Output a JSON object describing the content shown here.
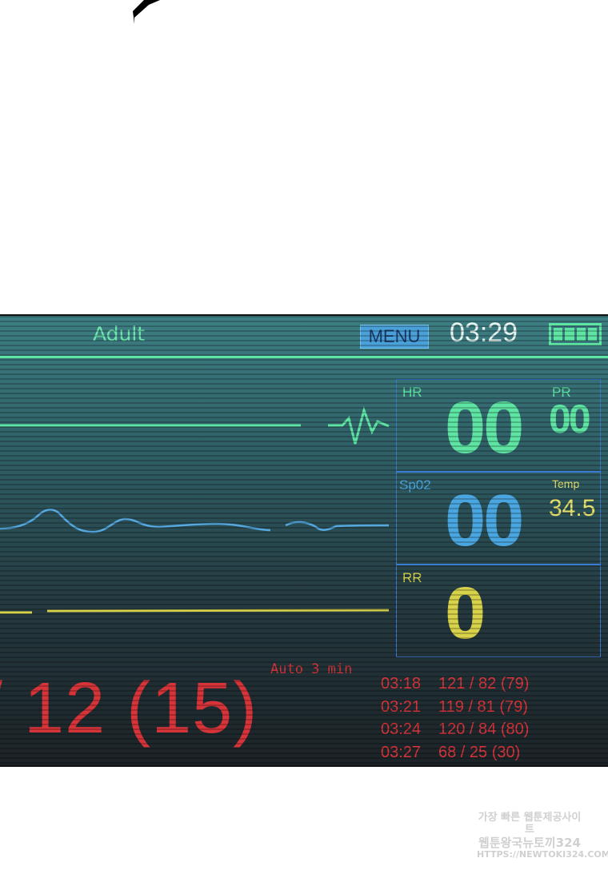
{
  "header": {
    "mode": "Adult",
    "menu_label": "MENU",
    "time": "03:29",
    "battery_cells": 4
  },
  "vitals": {
    "hr": {
      "label": "HR",
      "value": "00",
      "color": "#5fe5a3"
    },
    "pr": {
      "label": "PR",
      "value": "00",
      "color": "#5fe5a3"
    },
    "spo2": {
      "label": "Sp02",
      "value": "00",
      "color": "#4aa6e0"
    },
    "temp": {
      "label": "Temp",
      "value": "34.5",
      "color": "#e6e06a"
    },
    "rr": {
      "label": "RR",
      "value": "0",
      "color": "#d8d24a"
    }
  },
  "nibp": {
    "auto_label": "Auto 3 min",
    "current": "/ 12 (15)",
    "log": [
      {
        "time": "03:18",
        "reading": "121 / 82 (79)"
      },
      {
        "time": "03:21",
        "reading": "119 / 81 (79)"
      },
      {
        "time": "03:24",
        "reading": "120 / 84 (80)"
      },
      {
        "time": "03:27",
        "reading": "68 / 25 (30)"
      }
    ]
  },
  "watermark": {
    "line1": "가장 빠른 웹툰제공사이트",
    "line2": "웹툰왕국뉴토끼324",
    "line3": "HTTPS://NEWTOKI324.COM"
  }
}
